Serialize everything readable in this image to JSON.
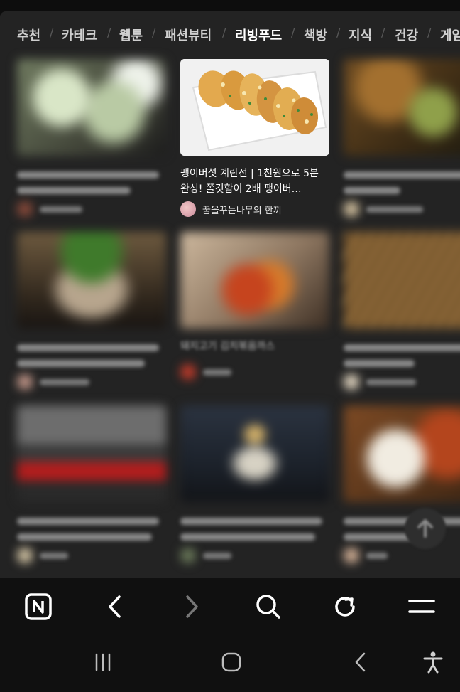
{
  "tabs": [
    {
      "label": "추천"
    },
    {
      "label": "카테크"
    },
    {
      "label": "웹툰"
    },
    {
      "label": "패션뷰티"
    },
    {
      "label": "리빙푸드",
      "active": true
    },
    {
      "label": "책방"
    },
    {
      "label": "지식"
    },
    {
      "label": "건강"
    },
    {
      "label": "게임"
    }
  ],
  "feed": {
    "featured": {
      "title": "팽이버섯 계란전 | 1천원으로 5분 완성! 쫄깃함이 2배 팽이버…",
      "author": "꿈을꾸는나무의 한끼"
    },
    "blurred_title_fragment": "돼지고기 김치볶음까스"
  },
  "toolbar": {
    "icons": [
      "naver-icon",
      "back-icon",
      "forward-icon",
      "search-icon",
      "refresh-icon",
      "menu-icon"
    ]
  },
  "system_nav": {
    "icons": [
      "recent-apps-icon",
      "home-icon",
      "back-icon",
      "accessibility-icon"
    ]
  }
}
